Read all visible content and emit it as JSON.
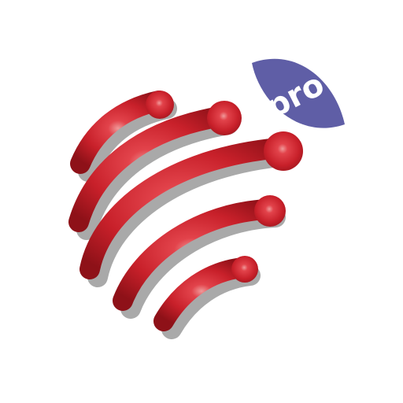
{
  "app_icon": {
    "badge_label": "pro",
    "colors": {
      "background": "#ffffff",
      "stripe_red": "#c8202a",
      "stripe_red_dark": "#8e1118",
      "stripe_highlight": "#f09a9a",
      "shadow_grey": "#a9a9a9",
      "badge_purple": "#5f5ea6",
      "badge_text": "#ffffff"
    },
    "icons": [
      "red-globe-stripes-icon",
      "pro-badge-icon"
    ]
  }
}
